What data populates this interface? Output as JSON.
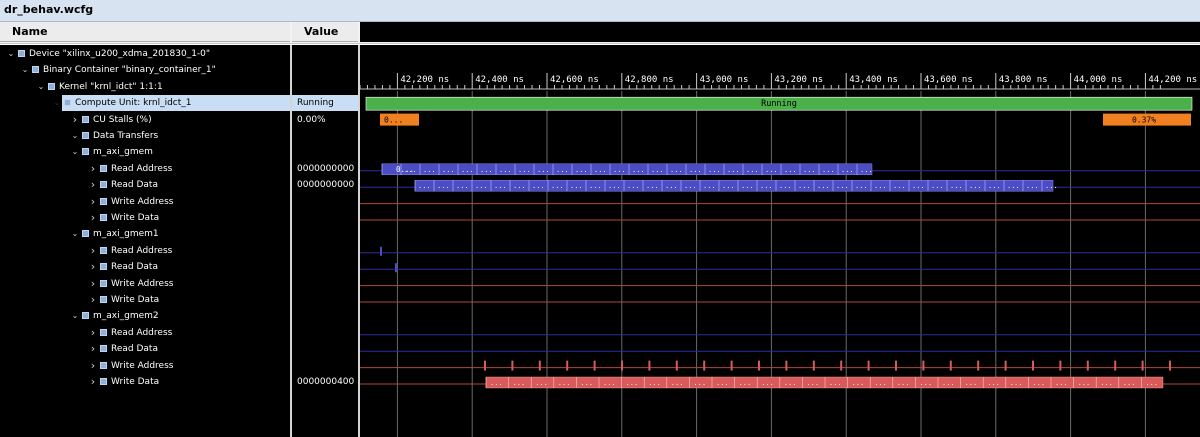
{
  "window": {
    "tab_title": "dr_behav.wcfg"
  },
  "toolbar": {
    "buttons": [
      {
        "name": "search-icon",
        "glyph": "⚲"
      },
      {
        "name": "save-icon",
        "glyph": "▣"
      },
      {
        "name": "zoom-in-icon",
        "glyph": "⊕"
      },
      {
        "name": "zoom-out-icon",
        "glyph": "⊖"
      },
      {
        "name": "zoom-fit-icon",
        "glyph": "⤧"
      },
      {
        "name": "go-to-cursor-icon",
        "glyph": "•|"
      },
      {
        "name": "go-to-start-icon",
        "glyph": "|◀"
      },
      {
        "name": "go-to-end-icon",
        "glyph": "▶|"
      },
      {
        "name": "swap-cursors-icon",
        "glyph": "⇅"
      },
      {
        "name": "previous-transition-icon",
        "glyph": "⤺"
      },
      {
        "name": "next-transition-icon",
        "glyph": "⤻"
      },
      {
        "name": "add-marker-icon",
        "glyph": "+|"
      },
      {
        "name": "previous-marker-icon",
        "glyph": "|◂"
      },
      {
        "name": "next-marker-icon",
        "glyph": "▸|"
      },
      {
        "name": "bounding-box-icon",
        "glyph": "⊢⊣"
      }
    ]
  },
  "columns": {
    "name": "Name",
    "value": "Value"
  },
  "tree": [
    {
      "label": "Device \"xilinx_u200_xdma_201830_1-0\"",
      "value": "",
      "level": 0,
      "expanded": true
    },
    {
      "label": "Binary Container \"binary_container_1\"",
      "value": "",
      "level": 1,
      "expanded": true
    },
    {
      "label": "Kernel \"krnl_idct\" 1:1:1",
      "value": "",
      "level": 2,
      "expanded": true
    },
    {
      "label": "Compute Unit: krnl_idct_1",
      "value": "Running",
      "level": 3,
      "expanded": true,
      "selected": true
    },
    {
      "label": "CU Stalls (%)",
      "value": "0.00%",
      "level": 4,
      "expanded": false
    },
    {
      "label": "Data Transfers",
      "value": "",
      "level": 4,
      "expanded": true
    },
    {
      "label": "m_axi_gmem",
      "value": "",
      "level": 5,
      "expanded": true
    },
    {
      "label": "Read Address",
      "value": "0000000000",
      "level": 6,
      "expanded": false
    },
    {
      "label": "Read Data",
      "value": "0000000000",
      "level": 6,
      "expanded": false
    },
    {
      "label": "Write Address",
      "value": "",
      "level": 6,
      "expanded": false
    },
    {
      "label": "Write Data",
      "value": "",
      "level": 6,
      "expanded": false
    },
    {
      "label": "m_axi_gmem1",
      "value": "",
      "level": 5,
      "expanded": true
    },
    {
      "label": "Read Address",
      "value": "",
      "level": 6,
      "expanded": false
    },
    {
      "label": "Read Data",
      "value": "",
      "level": 6,
      "expanded": false
    },
    {
      "label": "Write Address",
      "value": "",
      "level": 6,
      "expanded": false
    },
    {
      "label": "Write Data",
      "value": "",
      "level": 6,
      "expanded": false
    },
    {
      "label": "m_axi_gmem2",
      "value": "",
      "level": 5,
      "expanded": true
    },
    {
      "label": "Read Address",
      "value": "",
      "level": 6,
      "expanded": false
    },
    {
      "label": "Read Data",
      "value": "",
      "level": 6,
      "expanded": false
    },
    {
      "label": "Write Address",
      "value": "",
      "level": 6,
      "expanded": false
    },
    {
      "label": "Write Data",
      "value": "0000000400",
      "level": 6,
      "expanded": false
    }
  ],
  "timeline": {
    "unit": "ns",
    "ticks": [
      "42,200 ns",
      "42,400 ns",
      "42,600 ns",
      "42,800 ns",
      "43,000 ns",
      "43,200 ns",
      "43,400 ns",
      "43,600 ns",
      "43,800 ns",
      "44,000 ns",
      "44,200 ns"
    ],
    "running_label": "Running",
    "stall_start_label": "0...",
    "stall_end_label": "0.37%",
    "read_address_start_label": "0..."
  },
  "colors": {
    "running": "#4cb04a",
    "stall": "#f08020",
    "transfer": "#4c4cc4",
    "write": "#d95a5a",
    "row_line_blue": "#2c2c9c",
    "row_line_red": "#b04a3a",
    "background": "#000000"
  }
}
